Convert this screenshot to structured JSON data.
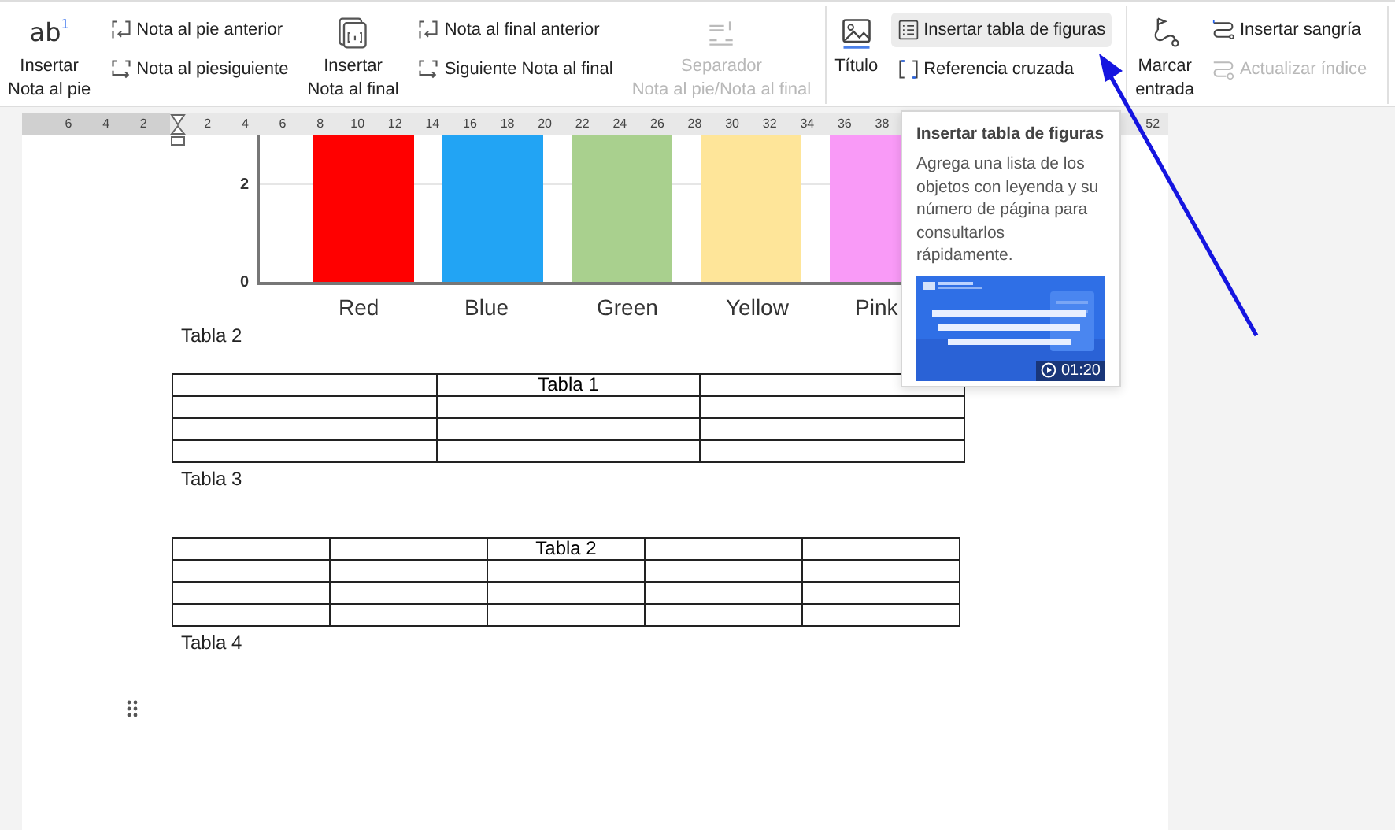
{
  "ribbon": {
    "groups": [
      {
        "controls": [
          {
            "kind": "large",
            "glyph": "ab",
            "glyph_sup": "1",
            "lines": [
              "Insertar",
              "Nota al pie"
            ],
            "disabled": false,
            "hovered": false
          },
          {
            "kind": "stack",
            "buttons": [
              {
                "label": "Nota al pie anterior",
                "disabled": false,
                "hovered": false
              },
              {
                "label": "Nota al piesiguiente",
                "disabled": false,
                "hovered": false
              }
            ]
          },
          {
            "kind": "large",
            "lines": [
              "Insertar",
              "Nota al final"
            ],
            "disabled": false,
            "hovered": false
          },
          {
            "kind": "stack",
            "buttons": [
              {
                "label": "Nota al final anterior",
                "disabled": false,
                "hovered": false
              },
              {
                "label": "Siguiente Nota al final",
                "disabled": false,
                "hovered": false
              }
            ]
          },
          {
            "kind": "large",
            "lines": [
              "Separador",
              "Nota al pie/Nota al final"
            ],
            "disabled": true,
            "hovered": false
          }
        ]
      },
      {
        "controls": [
          {
            "kind": "large",
            "lines": [
              "Título"
            ],
            "disabled": false,
            "hovered": false
          },
          {
            "kind": "stack",
            "buttons": [
              {
                "label": "Insertar tabla de figuras",
                "disabled": false,
                "hovered": true
              },
              {
                "label": "Referencia cruzada",
                "disabled": false,
                "hovered": false
              }
            ]
          }
        ]
      },
      {
        "controls": [
          {
            "kind": "large",
            "lines": [
              "Marcar",
              "entrada"
            ],
            "disabled": false,
            "hovered": false
          },
          {
            "kind": "stack",
            "buttons": [
              {
                "label": "Insertar sangría",
                "disabled": false,
                "hovered": false
              },
              {
                "label": "Actualizar índice",
                "disabled": true,
                "hovered": false
              }
            ]
          }
        ]
      }
    ]
  },
  "ruler": {
    "left_ticks": [
      "6",
      "4",
      "2"
    ],
    "right_ticks": [
      "2",
      "4",
      "6",
      "8",
      "10",
      "12",
      "14",
      "16",
      "18",
      "20",
      "22",
      "24",
      "26",
      "28",
      "30",
      "32",
      "34",
      "36",
      "38"
    ],
    "end_tick": "52"
  },
  "document": {
    "chart": {
      "yticks": [
        "2",
        "0"
      ],
      "categories": [
        {
          "label": "Red",
          "color": "#ff0000"
        },
        {
          "label": "Blue",
          "color": "#22a4f4"
        },
        {
          "label": "Green",
          "color": "#a9d08e"
        },
        {
          "label": "Yellow",
          "color": "#fee599"
        },
        {
          "label": "Pink",
          "color": "#f99af7"
        }
      ]
    },
    "blocks": [
      {
        "kind": "caption",
        "text": "Tabla 2"
      },
      {
        "kind": "table",
        "rows": [
          [
            "",
            "Tabla 1",
            ""
          ],
          [
            "",
            "",
            ""
          ],
          [
            "",
            "",
            ""
          ],
          [
            "",
            "",
            ""
          ]
        ]
      },
      {
        "kind": "caption",
        "text": "Tabla 3"
      },
      {
        "kind": "table",
        "rows": [
          [
            "",
            "",
            "Tabla 2",
            "",
            ""
          ],
          [
            "",
            "",
            "",
            "",
            ""
          ],
          [
            "",
            "",
            "",
            "",
            ""
          ],
          [
            "",
            "",
            "",
            "",
            ""
          ]
        ]
      },
      {
        "kind": "caption",
        "text": "Tabla 4"
      }
    ]
  },
  "tooltip": {
    "title": "Insertar tabla de figuras",
    "text": "Agrega una lista de los objetos con leyenda y su número de página para consultarlos rápidamente.",
    "video": {
      "kind": "picture",
      "duration": "01:20"
    }
  }
}
